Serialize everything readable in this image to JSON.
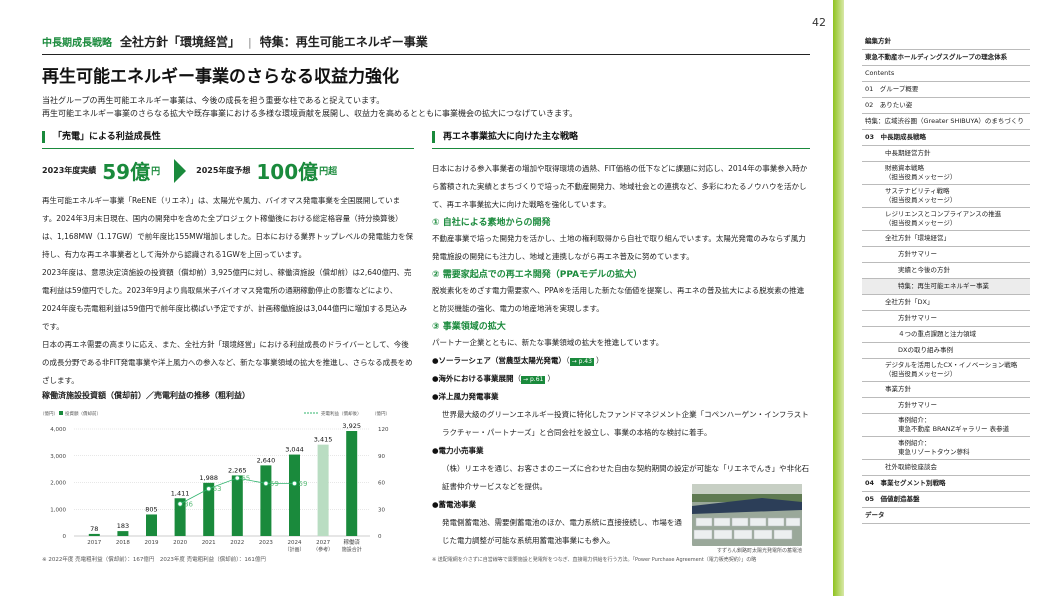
{
  "page_number": "42",
  "header": {
    "section": "中長期成長戦略",
    "main": "全社方針「環境経営」",
    "separator": "|",
    "sub": "特集：再生可能エネルギー事業"
  },
  "title": "再生可能エネルギー事業のさらなる収益力強化",
  "intro": [
    "当社グループの再生可能エネルギー事業は、今後の成長を担う重要な柱であると捉えています。",
    "再生可能エネルギー事業のさらなる拡大や既存事業における多様な環境貢献を展開し、収益力を高めるとともに事業機会の拡大につなげていきます。"
  ],
  "left": {
    "heading": "「売電」による利益成長性",
    "kpi1": {
      "label": "2023年度実績",
      "value": "59億",
      "unit": "円"
    },
    "kpi2": {
      "label": "2025年度予想",
      "value": "100億",
      "unit": "円超"
    },
    "paragraphs": [
      "再生可能エネルギー事業「ReENE（リエネ）」は、太陽光や風力、バイオマス発電事業を全国展開しています。2024年3月末日現在、国内の開発中を含めた全プロジェクト稼働後における総定格容量（持分換算後）は、1,168MW（1.17GW）で前年度比155MW増加しました。日本における業界トップレベルの発電能力を保持し、有力な再エネ事業者として海外から認識される1GWを上回っています。",
      "2023年度は、意思決定済施設の投資額（償却前）3,925億円に対し、稼働済施設（償却前）は2,640億円、売電利益は59億円でした。2023年9月より鳥取県米子バイオマス発電所の通期稼動停止の影響などにより、2024年度も売電粗利益は59億円で前年度比横ばい予定ですが、計画稼働施設は3,044億円に増加する見込みです。",
      "日本の再エネ需要の高まりに応え、また、全社方針「環境経営」における利益成長のドライバーとして、今後の成長分野である非FIT発電事業や洋上風力への参入など、新たな事業領域の拡大を推進し、さらなる成長をめざします。"
    ],
    "chart_title": "稼働済施設投資額（償却前）／売電利益の推移（粗利益）",
    "chart_note": "※ 2022年度 売電粗利益（償却前）：167億円　2023年度 売電粗利益（償却前）：161億円"
  },
  "chart_data": {
    "type": "bar",
    "left_axis_label": "（億円）",
    "left_legend": "投資額（償却前）",
    "right_axis_label": "（億円）",
    "right_legend": "売電利益（償却後）",
    "categories": [
      "2017",
      "2018",
      "2019",
      "2020",
      "2021",
      "2022",
      "2023",
      "2024",
      "2027",
      "稼働済"
    ],
    "category_sub": [
      "",
      "",
      "",
      "",
      "",
      "",
      "",
      "（計画）",
      "（参考）",
      "施設合計"
    ],
    "values": [
      78,
      183,
      805,
      1411,
      1988,
      2265,
      2640,
      3044,
      3415,
      3925
    ],
    "value_labels": [
      "78",
      "183",
      "805",
      "1,411",
      "1,988",
      "2,265",
      "2,640",
      "3,044",
      "3,415",
      "3,925"
    ],
    "profit_values": [
      36,
      53,
      65,
      59,
      59
    ],
    "profit_labels": [
      "36",
      "53",
      "65",
      "59",
      "59"
    ],
    "profit_index": [
      3,
      4,
      5,
      6,
      7
    ],
    "left_ticks": [
      "0",
      "1,000",
      "2,000",
      "3,000",
      "4,000"
    ],
    "left_tick_values": [
      0,
      1000,
      2000,
      3000,
      4000
    ],
    "right_ticks": [
      "0",
      "30",
      "60",
      "90",
      "120"
    ],
    "ylim": [
      0,
      4000
    ],
    "y2lim": [
      0,
      120
    ],
    "colors": {
      "bar": "#1a8a3c",
      "bar_light": "#b9ddc2",
      "profit": "#31b46e",
      "profit_text": "#5dbd7a"
    }
  },
  "right": {
    "heading": "再エネ事業拡大に向けた主な戦略",
    "intro": "日本における参入事業者の増加や取得環境の過熱、FIT価格の低下などに課題に対応し、2014年の事業参入時から蓄積された実績とまちづくりで培った不動産開発力、地域社会との連携など、多彩にわたるノウハウを活かして、再エネ事業拡大に向けた戦略を強化しています。",
    "s1_title": "① 自社による素地からの開発",
    "s1_body": "不動産事業で培った開発力を活かし、土地の権利取得から自社で取り組んでいます。太陽光発電のみならず風力発電施設の開発にも注力し、地域と連携しながら再エネ普及に努めています。",
    "s2_title": "② 需要家起点での再エネ開発（PPAモデルの拡大）",
    "s2_body": "脱炭素化をめざす電力需要家へ、PPA※を活用した新たな価値を提案し、再エネの普及拡大による脱炭素の推進と防災機能の強化、電力の地産地消を実現します。",
    "s3_title": "③ 事業領域の拡大",
    "s3_body": "パートナー企業とともに、新たな事業領域の拡大を推進しています。",
    "b1": "●ソーラーシェア（営農型太陽光発電）",
    "b1_ref": "→ p.43",
    "b2": "●海外における事業展開",
    "b2_ref": "→ p.61",
    "b3": "●洋上風力発電事業",
    "b3_body": "世界最大級のグリーンエネルギー投資に特化したファンドマネジメント企業「コペンハーゲン・インフラストラクチャー・パートナーズ」と合同会社を設立し、事業の本格的な検討に着手。",
    "b4": "●電力小売事業",
    "b4_body": "（株）リエネを通じ、お客さまのニーズに合わせた自由な契約期間の設定が可能な「リエネでんき」や非化石証書仲介サービスなどを提供。",
    "b5": "●蓄電池事業",
    "b5_body": "発電側蓄電池、需要側蓄電池のほか、電力系統に直接接続し、市場を通じた電力調整が可能な系統用蓄電池事業にも参入。",
    "photo_caption": "すずらん釧路町太陽光発電所の蓄電池",
    "footnote": "※ 送配電網を介さずに自営線等で需要施設と発電所をつなぎ、直接電力供給を行う方法。「Power Purchase Agreement（電力販売契約）」の略"
  },
  "nav": [
    {
      "label": "編集方針",
      "lv": 1
    },
    {
      "label": "東急不動産ホールディングスグループの理念体系",
      "lv": 1
    },
    {
      "label": "Contents",
      "lv": 0
    },
    {
      "label": "01　グループ概要",
      "lv": 0
    },
    {
      "label": "02　ありたい姿",
      "lv": 0
    },
    {
      "label": "特集：広域渋谷圏（Greater SHIBUYA）のまちづくり",
      "lv": 0
    },
    {
      "label": "03　中長期成長戦略",
      "lv": 1
    },
    {
      "label": "中長期経営方針",
      "lv": 2
    },
    {
      "label": "財務資本戦略\n（担当役員メッセージ）",
      "lv": 2
    },
    {
      "label": "サステナビリティ戦略\n（担当役員メッセージ）",
      "lv": 2
    },
    {
      "label": "レジリエンスとコンプライアンスの推進\n（担当役員メッセージ）",
      "lv": 2
    },
    {
      "label": "全社方針「環境経営」",
      "lv": 2
    },
    {
      "label": "方針サマリー",
      "lv": 3
    },
    {
      "label": "実績と今後の方針",
      "lv": 3
    },
    {
      "label": "特集：再生可能エネルギー事業",
      "lv": 3,
      "active": true
    },
    {
      "label": "全社方針「DX」",
      "lv": 2
    },
    {
      "label": "方針サマリー",
      "lv": 3
    },
    {
      "label": "４つの重点課題と注力領域",
      "lv": 3
    },
    {
      "label": "DXの取り組み事例",
      "lv": 3
    },
    {
      "label": "デジタルを活用したCX・イノベーション戦略\n（担当役員メッセージ）",
      "lv": 2
    },
    {
      "label": "事業方針",
      "lv": 2
    },
    {
      "label": "方針サマリー",
      "lv": 3
    },
    {
      "label": "事例紹介：\n東急不動産 BRANZギャラリー 表参道",
      "lv": 3
    },
    {
      "label": "事例紹介：\n東急リゾートタウン蓼科",
      "lv": 3
    },
    {
      "label": "社外取締役座談会",
      "lv": 2
    },
    {
      "label": "04　事業セグメント別戦略",
      "lv": 1
    },
    {
      "label": "05　価値創造基盤",
      "lv": 1
    },
    {
      "label": "データ",
      "lv": 1
    }
  ]
}
